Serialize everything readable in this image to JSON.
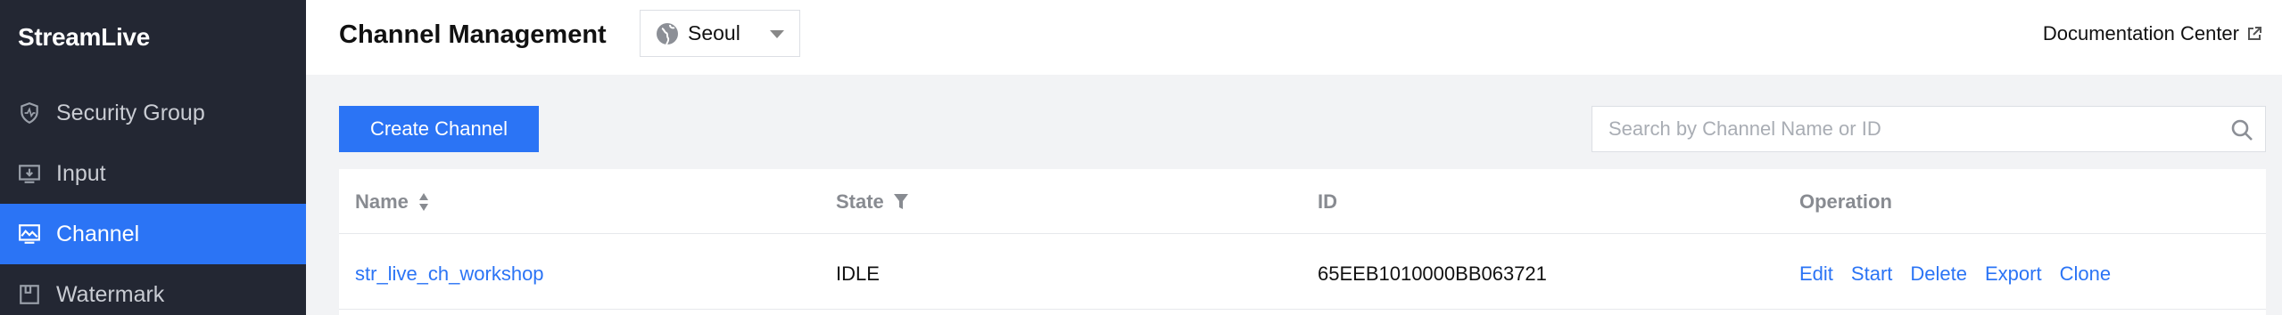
{
  "app": {
    "name": "StreamLive"
  },
  "sidebar": {
    "items": [
      {
        "label": "Security Group",
        "icon": "shield-icon"
      },
      {
        "label": "Input",
        "icon": "input-icon"
      },
      {
        "label": "Channel",
        "icon": "channel-icon",
        "active": true
      },
      {
        "label": "Watermark",
        "icon": "watermark-icon"
      }
    ]
  },
  "header": {
    "title": "Channel Management",
    "region": "Seoul",
    "doc_link": "Documentation Center"
  },
  "toolbar": {
    "create_label": "Create Channel",
    "search_placeholder": "Search by Channel Name or ID"
  },
  "table": {
    "columns": [
      "Name",
      "State",
      "ID",
      "Operation"
    ],
    "rows": [
      {
        "name": "str_live_ch_workshop",
        "state": "IDLE",
        "id": "65EEB1010000BB063721",
        "operations": [
          "Edit",
          "Start",
          "Delete",
          "Export",
          "Clone"
        ]
      }
    ]
  },
  "colors": {
    "accent": "#2b74f5",
    "sidebar_bg": "#232733",
    "page_bg": "#f2f3f5"
  }
}
